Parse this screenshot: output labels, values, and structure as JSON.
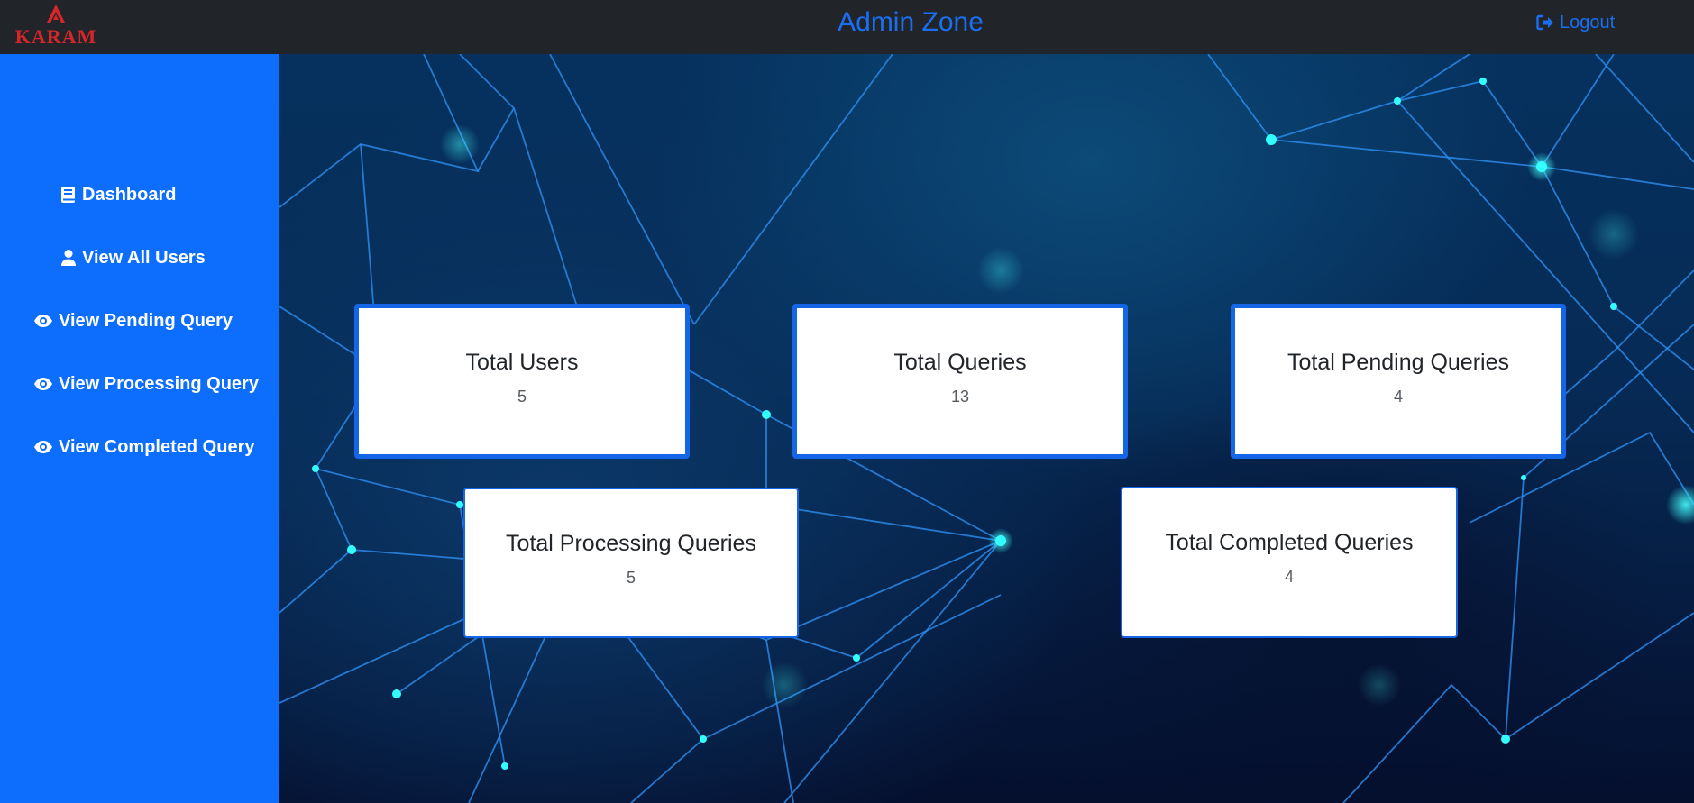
{
  "header": {
    "logo_text": "KARAM",
    "title": "Admin Zone",
    "logout_label": "Logout",
    "logout_icon": "sign-out-icon",
    "accent_color": "#1a6ff0",
    "background_color": "#212529"
  },
  "sidebar": {
    "background_color": "#0d6efd",
    "items": [
      {
        "label": "Dashboard",
        "icon": "book-icon"
      },
      {
        "label": "View All Users",
        "icon": "user-icon"
      },
      {
        "label": "View Pending Query",
        "icon": "eye-icon"
      },
      {
        "label": "View Processing Query",
        "icon": "eye-icon"
      },
      {
        "label": "View Completed Query",
        "icon": "eye-icon"
      }
    ]
  },
  "stats": [
    {
      "title": "Total Users",
      "value": "5"
    },
    {
      "title": "Total Queries",
      "value": "13"
    },
    {
      "title": "Total Pending Queries",
      "value": "4"
    },
    {
      "title": "Total Processing Queries",
      "value": "5"
    },
    {
      "title": "Total Completed Queries",
      "value": "4"
    }
  ]
}
